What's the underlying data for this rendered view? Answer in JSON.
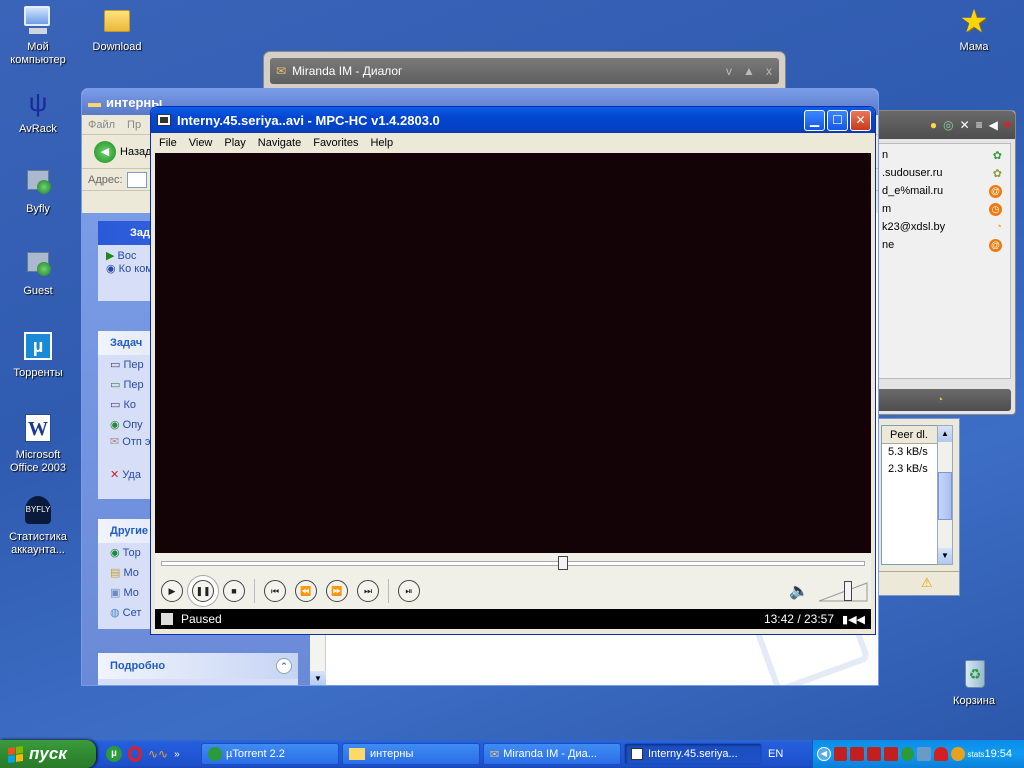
{
  "desktop": {
    "icons_left": [
      {
        "label": "Мой компьютер",
        "icon": "my-computer-icon"
      },
      {
        "label": "Download",
        "icon": "folder-icon"
      },
      {
        "label": "AvRack",
        "icon": "avrack-icon"
      },
      {
        "label": "Byfly",
        "icon": "network-shortcut-icon"
      },
      {
        "label": "Guest",
        "icon": "network-shortcut-icon"
      },
      {
        "label": "Торренты",
        "icon": "utorrent-icon"
      },
      {
        "label": "Microsoft Office 2003",
        "icon": "word-icon"
      },
      {
        "label": "Статистика аккаунта...",
        "icon": "byfly-stats-icon"
      }
    ],
    "icons_right": [
      {
        "label": "Мама",
        "icon": "star-icon"
      },
      {
        "label": "Корзина",
        "icon": "recycle-bin-icon"
      }
    ]
  },
  "miranda_dialog": {
    "title": "Miranda IM - Диалог",
    "buttons": [
      "v",
      "▲",
      "x"
    ]
  },
  "explorer": {
    "title": "интерны",
    "menu": [
      "Файл",
      "Пр"
    ],
    "back_label": "Назад",
    "address_label": "Адрес:",
    "panel_video": {
      "title": "Зада",
      "items": [
        "Вос",
        "Ко ком"
      ]
    },
    "panel_tasks": {
      "title": "Задач",
      "items": [
        "Пер",
        "Пер",
        "Ко",
        "Опу",
        "Отп эле",
        "Уда"
      ]
    },
    "panel_other": {
      "title": "Другие",
      "items": [
        "Тор",
        "Мо",
        "Мо",
        "Сет"
      ]
    },
    "panel_details": {
      "title": "Подробно"
    }
  },
  "contacts": {
    "entries": [
      {
        "text": "n",
        "status": "online-green"
      },
      {
        "text": ".sudouser.ru",
        "status": "online-green"
      },
      {
        "text": "d_e%mail.ru",
        "status": "mail-orange"
      },
      {
        "text": "m",
        "status": "clock-orange"
      },
      {
        "text": "k23@xdsl.by",
        "status": "away-yellow"
      },
      {
        "text": "ne",
        "status": "mail-orange"
      }
    ]
  },
  "utorrent": {
    "column_header": "Peer dl.",
    "values": [
      "5.3 kB/s",
      "2.3 kB/s"
    ]
  },
  "player": {
    "title": "Interny.45.seriya..avi - MPC-HC v1.4.2803.0",
    "menu": [
      "File",
      "View",
      "Play",
      "Navigate",
      "Favorites",
      "Help"
    ],
    "status": "Paused",
    "time": "13:42 / 23:57",
    "seek_position": 0.57,
    "volume_level": 0.6,
    "video_bg": "#140306"
  },
  "taskbar": {
    "start_label": "пуск",
    "items": [
      {
        "label": "µTorrent 2.2",
        "icon": "utorrent-icon"
      },
      {
        "label": "интерны",
        "icon": "folder-icon"
      },
      {
        "label": "Miranda IM - Диа...",
        "icon": "miranda-icon"
      },
      {
        "label": "Interny.45.seriya...",
        "icon": "mpc-icon",
        "active": true
      }
    ],
    "lang": "EN",
    "clock": "19:54",
    "tray_text": "stats"
  },
  "colors": {
    "taskbar": "#245edb",
    "start": "#2f8a2f",
    "title_active": "#0446d0"
  }
}
